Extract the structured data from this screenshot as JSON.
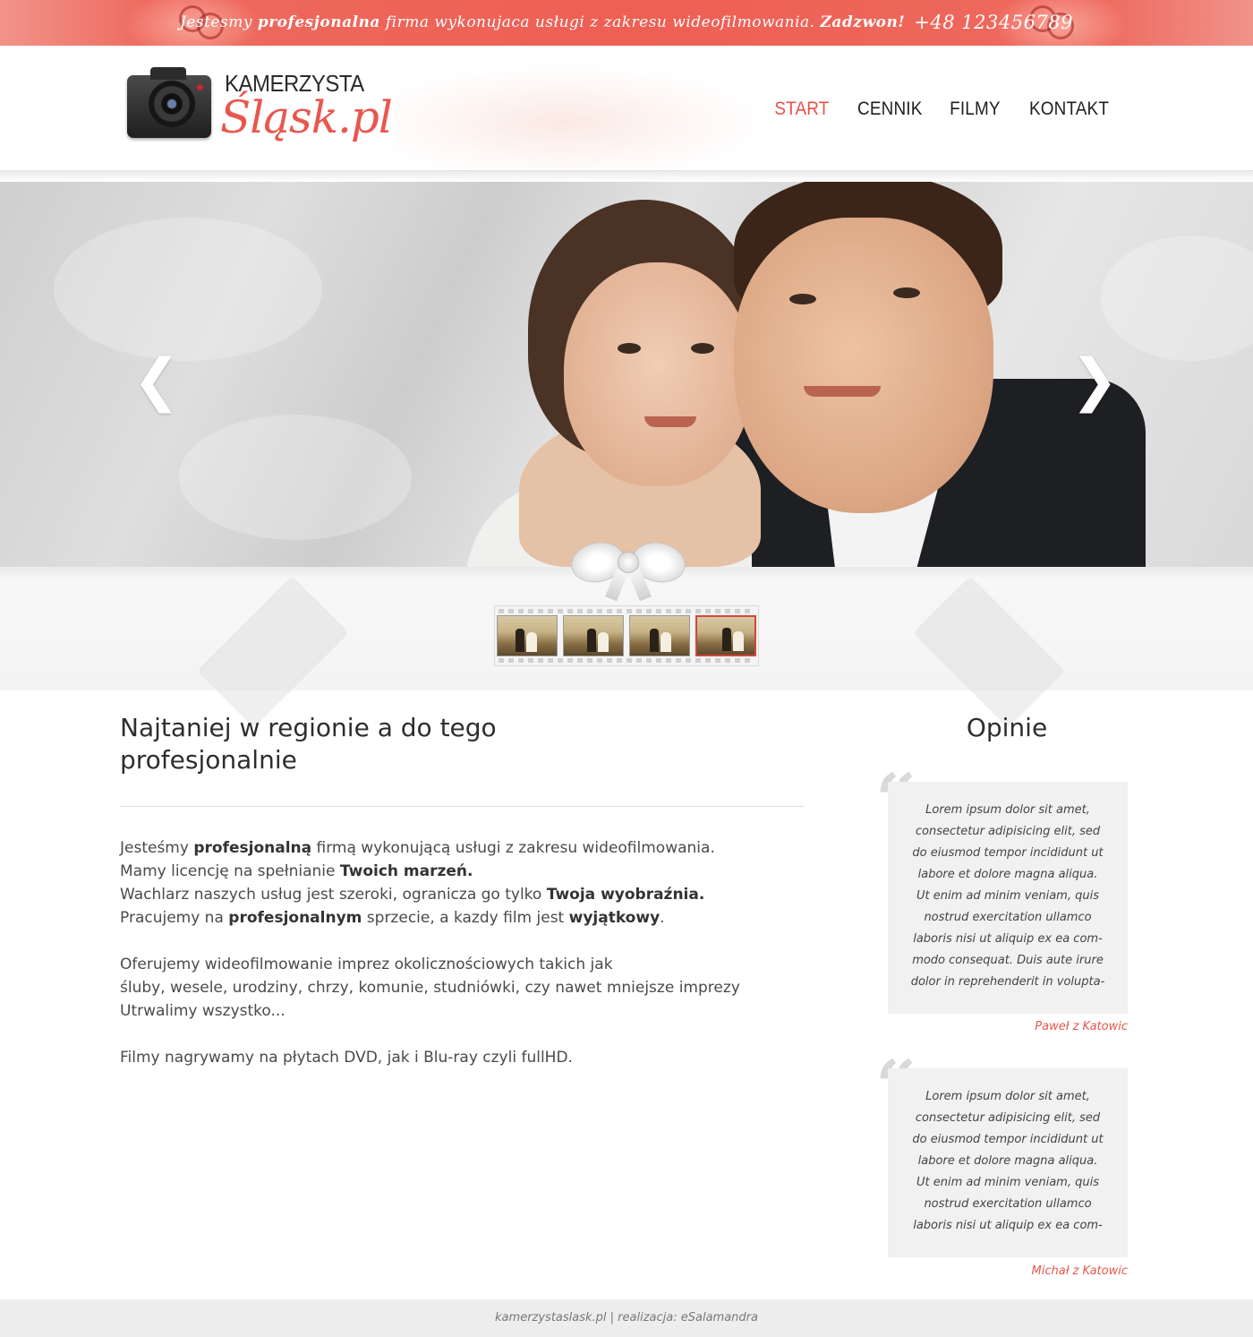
{
  "topbar": {
    "message_pre": "Jestesmy",
    "message_bold": "profesjonalna",
    "message_post": "firma wykonujaca usługi z zakresu wideofilmowania.",
    "call": "Zadzwon!",
    "phone": "+48 123456789",
    "icons": [
      "wedding-rings-icon",
      "wedding-rings-icon"
    ]
  },
  "logo": {
    "line1": "KAMERZYSTA",
    "line2": "Śląsk.pl",
    "icon": "camera-icon"
  },
  "nav": {
    "items": [
      {
        "label": "START",
        "active": true
      },
      {
        "label": "CENNIK",
        "active": false
      },
      {
        "label": "FILMY",
        "active": false
      },
      {
        "label": "KONTAKT",
        "active": false
      }
    ]
  },
  "slider": {
    "prev_glyph": "❮",
    "next_glyph": "❯",
    "thumbnail_count": 4,
    "active_thumbnail": 4
  },
  "main": {
    "heading": "Najtaniej w regionie a do tego profesjonalnie",
    "p1": {
      "l1_a": "Jesteśmy ",
      "l1_b": "profesjonalną",
      "l1_c": " firmą wykonującą usługi z zakresu wideofilmowania.",
      "l2_a": "Mamy licencję na spełnianie ",
      "l2_b": "Twoich marzeń.",
      "l3_a": "Wachlarz naszych usług jest szeroki, ogranicza go tylko ",
      "l3_b": "Twoja wyobraźnia.",
      "l4_a": "Pracujemy na ",
      "l4_b": "profesjonalnym",
      "l4_c": " sprzecie, a kazdy film jest ",
      "l4_d": "wyjątkowy",
      "l4_e": "."
    },
    "p2": {
      "l1": "Oferujemy wideofilmowanie imprez okolicznościowych takich jak",
      "l2": "śluby, wesele, urodziny, chrzy, komunie, studniówki, czy nawet mniejsze imprezy",
      "l3": "Utrwalimy wszystko..."
    },
    "p3": "Filmy nagrywamy na płytach DVD, jak i Blu-ray czyli fullHD."
  },
  "opinions": {
    "title": "Opinie",
    "quote_glyph": "“",
    "items": [
      {
        "lines": [
          "Lorem ipsum dolor sit amet,",
          "consectetur adipisicing elit, sed",
          "do eiusmod tempor incididunt ut",
          "labore et dolore magna aliqua.",
          "Ut enim ad minim veniam, quis",
          "nostrud exercitation ullamco",
          "laboris nisi ut aliquip ex ea com-",
          "modo consequat. Duis aute irure",
          "dolor in reprehenderit in volupta-"
        ],
        "author": "Paweł z Katowic"
      },
      {
        "lines": [
          "Lorem ipsum dolor sit amet,",
          "consectetur adipisicing elit, sed",
          "do eiusmod tempor incididunt ut",
          "labore et dolore magna aliqua.",
          "Ut enim ad minim veniam, quis",
          "nostrud exercitation ullamco",
          "laboris nisi ut aliquip ex ea com-"
        ],
        "author": "Michał z Katowic"
      }
    ]
  },
  "footer": {
    "text": "kamerzystaslask.pl | realizacja: eSalamandra"
  },
  "colors": {
    "accent": "#ea5147",
    "topbar": "#ee5f54",
    "text": "#4a4a4a",
    "quote_bg": "#f1f1f1",
    "footer_bg": "#ededed"
  }
}
